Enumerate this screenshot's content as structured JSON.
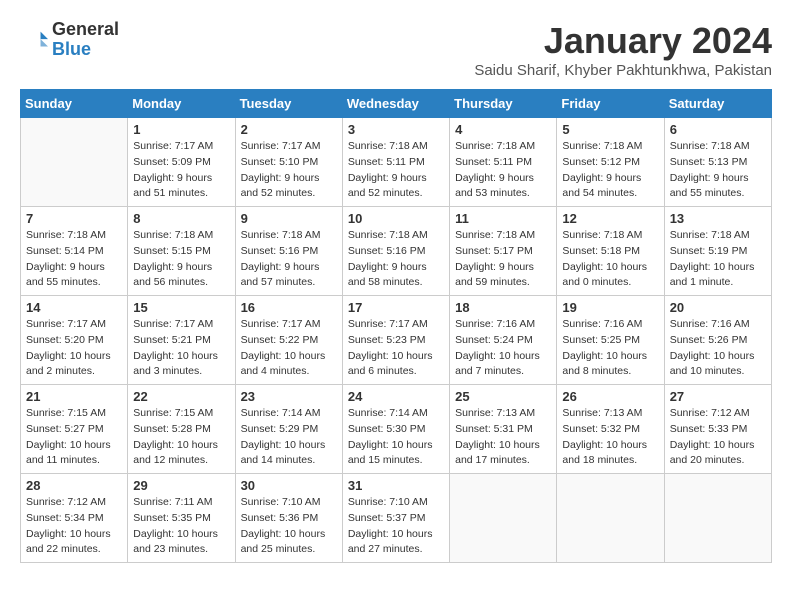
{
  "logo": {
    "general": "General",
    "blue": "Blue"
  },
  "header": {
    "month": "January 2024",
    "location": "Saidu Sharif, Khyber Pakhtunkhwa, Pakistan"
  },
  "days_of_week": [
    "Sunday",
    "Monday",
    "Tuesday",
    "Wednesday",
    "Thursday",
    "Friday",
    "Saturday"
  ],
  "weeks": [
    [
      {
        "day": "",
        "sunrise": "",
        "sunset": "",
        "daylight": ""
      },
      {
        "day": "1",
        "sunrise": "Sunrise: 7:17 AM",
        "sunset": "Sunset: 5:09 PM",
        "daylight": "Daylight: 9 hours and 51 minutes."
      },
      {
        "day": "2",
        "sunrise": "Sunrise: 7:17 AM",
        "sunset": "Sunset: 5:10 PM",
        "daylight": "Daylight: 9 hours and 52 minutes."
      },
      {
        "day": "3",
        "sunrise": "Sunrise: 7:18 AM",
        "sunset": "Sunset: 5:11 PM",
        "daylight": "Daylight: 9 hours and 52 minutes."
      },
      {
        "day": "4",
        "sunrise": "Sunrise: 7:18 AM",
        "sunset": "Sunset: 5:11 PM",
        "daylight": "Daylight: 9 hours and 53 minutes."
      },
      {
        "day": "5",
        "sunrise": "Sunrise: 7:18 AM",
        "sunset": "Sunset: 5:12 PM",
        "daylight": "Daylight: 9 hours and 54 minutes."
      },
      {
        "day": "6",
        "sunrise": "Sunrise: 7:18 AM",
        "sunset": "Sunset: 5:13 PM",
        "daylight": "Daylight: 9 hours and 55 minutes."
      }
    ],
    [
      {
        "day": "7",
        "sunrise": "Sunrise: 7:18 AM",
        "sunset": "Sunset: 5:14 PM",
        "daylight": "Daylight: 9 hours and 55 minutes."
      },
      {
        "day": "8",
        "sunrise": "Sunrise: 7:18 AM",
        "sunset": "Sunset: 5:15 PM",
        "daylight": "Daylight: 9 hours and 56 minutes."
      },
      {
        "day": "9",
        "sunrise": "Sunrise: 7:18 AM",
        "sunset": "Sunset: 5:16 PM",
        "daylight": "Daylight: 9 hours and 57 minutes."
      },
      {
        "day": "10",
        "sunrise": "Sunrise: 7:18 AM",
        "sunset": "Sunset: 5:16 PM",
        "daylight": "Daylight: 9 hours and 58 minutes."
      },
      {
        "day": "11",
        "sunrise": "Sunrise: 7:18 AM",
        "sunset": "Sunset: 5:17 PM",
        "daylight": "Daylight: 9 hours and 59 minutes."
      },
      {
        "day": "12",
        "sunrise": "Sunrise: 7:18 AM",
        "sunset": "Sunset: 5:18 PM",
        "daylight": "Daylight: 10 hours and 0 minutes."
      },
      {
        "day": "13",
        "sunrise": "Sunrise: 7:18 AM",
        "sunset": "Sunset: 5:19 PM",
        "daylight": "Daylight: 10 hours and 1 minute."
      }
    ],
    [
      {
        "day": "14",
        "sunrise": "Sunrise: 7:17 AM",
        "sunset": "Sunset: 5:20 PM",
        "daylight": "Daylight: 10 hours and 2 minutes."
      },
      {
        "day": "15",
        "sunrise": "Sunrise: 7:17 AM",
        "sunset": "Sunset: 5:21 PM",
        "daylight": "Daylight: 10 hours and 3 minutes."
      },
      {
        "day": "16",
        "sunrise": "Sunrise: 7:17 AM",
        "sunset": "Sunset: 5:22 PM",
        "daylight": "Daylight: 10 hours and 4 minutes."
      },
      {
        "day": "17",
        "sunrise": "Sunrise: 7:17 AM",
        "sunset": "Sunset: 5:23 PM",
        "daylight": "Daylight: 10 hours and 6 minutes."
      },
      {
        "day": "18",
        "sunrise": "Sunrise: 7:16 AM",
        "sunset": "Sunset: 5:24 PM",
        "daylight": "Daylight: 10 hours and 7 minutes."
      },
      {
        "day": "19",
        "sunrise": "Sunrise: 7:16 AM",
        "sunset": "Sunset: 5:25 PM",
        "daylight": "Daylight: 10 hours and 8 minutes."
      },
      {
        "day": "20",
        "sunrise": "Sunrise: 7:16 AM",
        "sunset": "Sunset: 5:26 PM",
        "daylight": "Daylight: 10 hours and 10 minutes."
      }
    ],
    [
      {
        "day": "21",
        "sunrise": "Sunrise: 7:15 AM",
        "sunset": "Sunset: 5:27 PM",
        "daylight": "Daylight: 10 hours and 11 minutes."
      },
      {
        "day": "22",
        "sunrise": "Sunrise: 7:15 AM",
        "sunset": "Sunset: 5:28 PM",
        "daylight": "Daylight: 10 hours and 12 minutes."
      },
      {
        "day": "23",
        "sunrise": "Sunrise: 7:14 AM",
        "sunset": "Sunset: 5:29 PM",
        "daylight": "Daylight: 10 hours and 14 minutes."
      },
      {
        "day": "24",
        "sunrise": "Sunrise: 7:14 AM",
        "sunset": "Sunset: 5:30 PM",
        "daylight": "Daylight: 10 hours and 15 minutes."
      },
      {
        "day": "25",
        "sunrise": "Sunrise: 7:13 AM",
        "sunset": "Sunset: 5:31 PM",
        "daylight": "Daylight: 10 hours and 17 minutes."
      },
      {
        "day": "26",
        "sunrise": "Sunrise: 7:13 AM",
        "sunset": "Sunset: 5:32 PM",
        "daylight": "Daylight: 10 hours and 18 minutes."
      },
      {
        "day": "27",
        "sunrise": "Sunrise: 7:12 AM",
        "sunset": "Sunset: 5:33 PM",
        "daylight": "Daylight: 10 hours and 20 minutes."
      }
    ],
    [
      {
        "day": "28",
        "sunrise": "Sunrise: 7:12 AM",
        "sunset": "Sunset: 5:34 PM",
        "daylight": "Daylight: 10 hours and 22 minutes."
      },
      {
        "day": "29",
        "sunrise": "Sunrise: 7:11 AM",
        "sunset": "Sunset: 5:35 PM",
        "daylight": "Daylight: 10 hours and 23 minutes."
      },
      {
        "day": "30",
        "sunrise": "Sunrise: 7:10 AM",
        "sunset": "Sunset: 5:36 PM",
        "daylight": "Daylight: 10 hours and 25 minutes."
      },
      {
        "day": "31",
        "sunrise": "Sunrise: 7:10 AM",
        "sunset": "Sunset: 5:37 PM",
        "daylight": "Daylight: 10 hours and 27 minutes."
      },
      {
        "day": "",
        "sunrise": "",
        "sunset": "",
        "daylight": ""
      },
      {
        "day": "",
        "sunrise": "",
        "sunset": "",
        "daylight": ""
      },
      {
        "day": "",
        "sunrise": "",
        "sunset": "",
        "daylight": ""
      }
    ]
  ]
}
